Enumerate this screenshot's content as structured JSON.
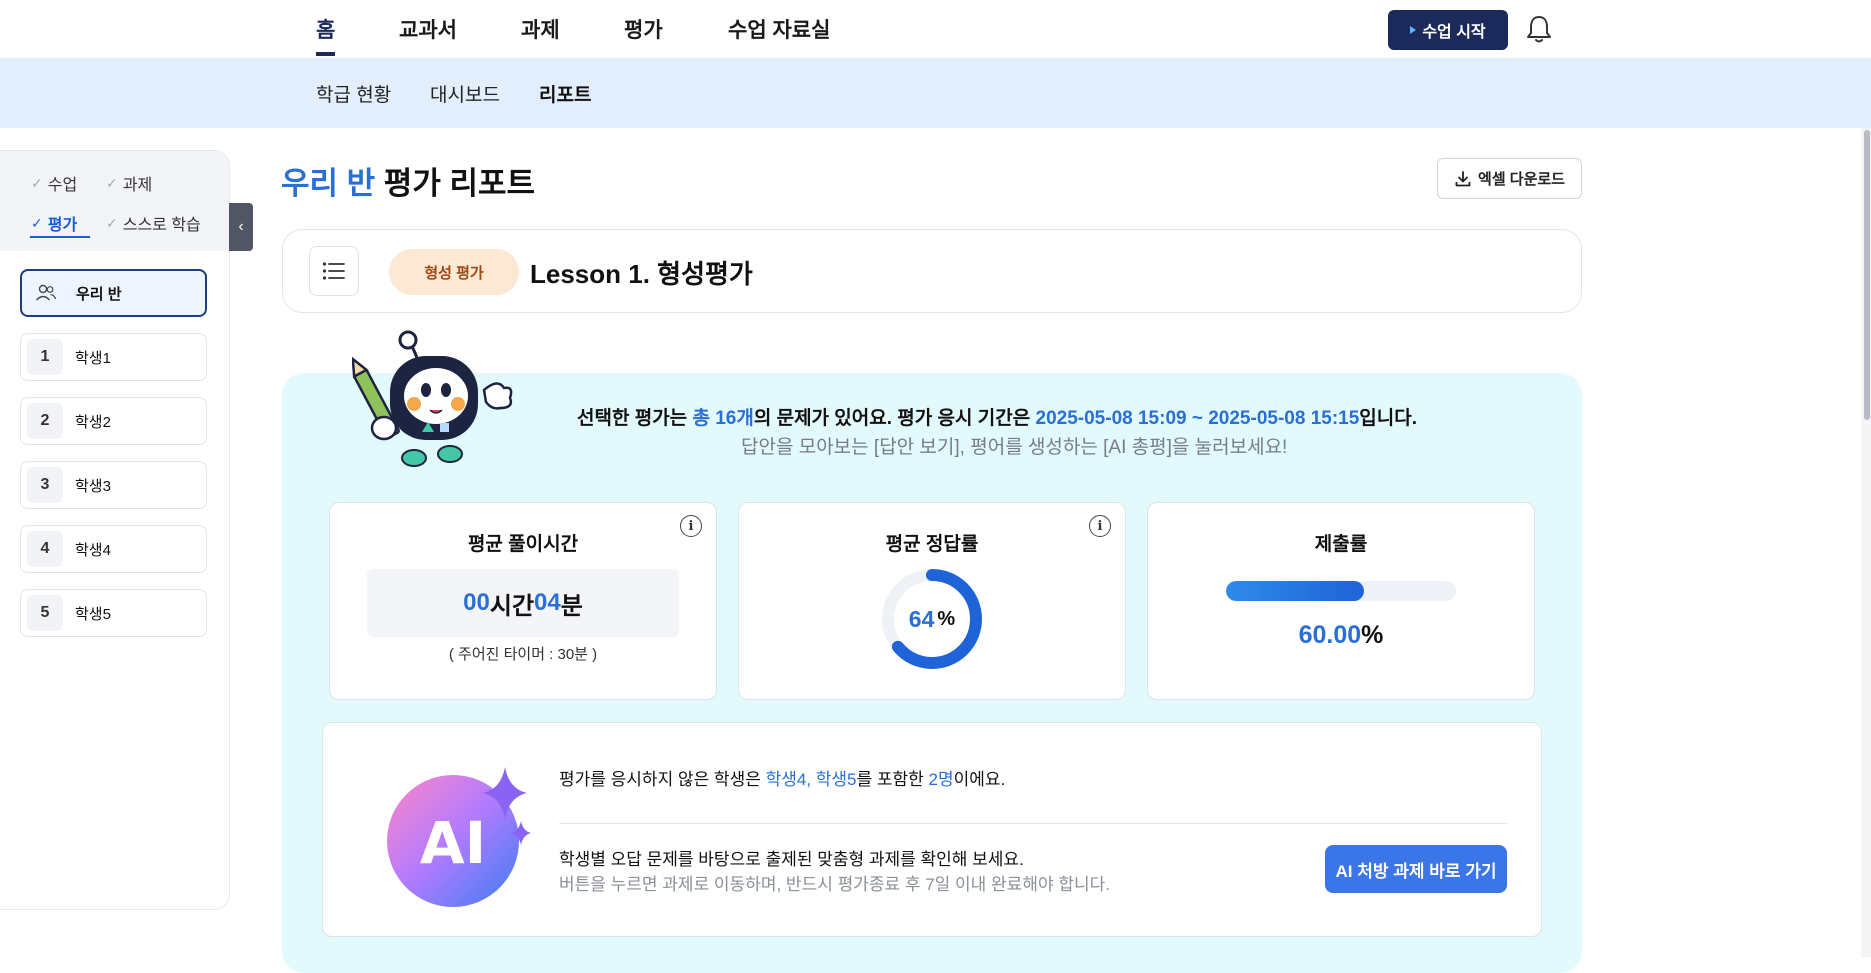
{
  "topnav": {
    "tabs": [
      "홈",
      "교과서",
      "과제",
      "평가",
      "수업 자료실"
    ],
    "start_button": "수업 시작"
  },
  "subnav": {
    "items": [
      "학급 현황",
      "대시보드",
      "리포트"
    ]
  },
  "sidebar": {
    "filters": [
      "수업",
      "과제",
      "평가",
      "스스로 학습"
    ],
    "class_label": "우리 반",
    "students": [
      {
        "num": "1",
        "name": "학생1"
      },
      {
        "num": "2",
        "name": "학생2"
      },
      {
        "num": "3",
        "name": "학생3"
      },
      {
        "num": "4",
        "name": "학생4"
      },
      {
        "num": "5",
        "name": "학생5"
      }
    ]
  },
  "header": {
    "title_blue": "우리 반",
    "title_rest": " 평가 리포트",
    "excel_button": "엑셀 다운로드"
  },
  "lesson": {
    "badge": "형성 평가",
    "title": "Lesson 1. 형성평가"
  },
  "summary": {
    "line1_a": "선택한 평가는 ",
    "line1_count": "총 16개",
    "line1_b": "의 문제가 있어요. 평가 응시 기간은 ",
    "line1_period": "2025-05-08 15:09 ~ 2025-05-08 15:15",
    "line1_c": "입니다.",
    "line2": "답안을 모아보는 [답안 보기], 평어를 생성하는 [AI 총평]을 눌러보세요!"
  },
  "cards": {
    "time": {
      "title": "평균 풀이시간",
      "hours": "00",
      "hours_unit": "시간 ",
      "minutes": "04",
      "minutes_unit": "분",
      "note": "( 주어진 타이머 : 30분 )"
    },
    "accuracy": {
      "title": "평균 정답률",
      "value": "64",
      "unit": "%",
      "fraction": 0.64
    },
    "submission": {
      "title": "제출률",
      "value": "60.00",
      "unit": "%",
      "fraction": 0.6
    }
  },
  "ai": {
    "line1_a": "평가를 응시하지 않은 학생은 ",
    "line1_names": "학생4, 학생5",
    "line1_b": "를 포함한 ",
    "line1_count": "2명",
    "line1_c": "이에요.",
    "line2": "학생별 오답 문제를 바탕으로 출제된 맞춤형 과제를 확인해 보세요.",
    "line3": "버튼을 누르면 과제로 이동하며, 반드시 평가종료 후 7일 이내 완료해야 합니다.",
    "button": "AI 처방 과제 바로 가기",
    "logo_text": "AI"
  },
  "colors": {
    "navy": "#1b2a5b",
    "accent_blue": "#2a6fd6",
    "subnav_bg": "#e3eefc",
    "panel_bg": "#e2fafc",
    "badge_bg": "#fde8d4"
  }
}
